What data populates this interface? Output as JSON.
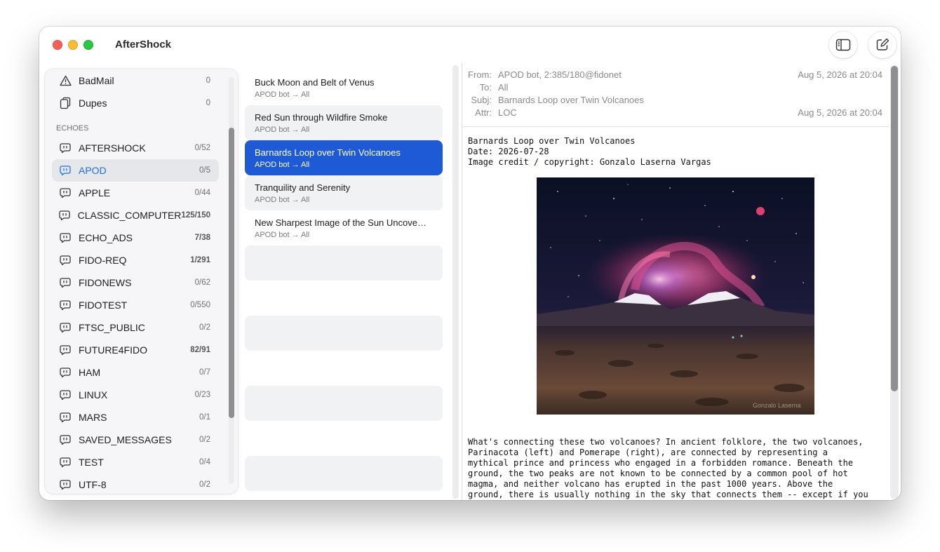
{
  "app": {
    "title": "AfterShock"
  },
  "toolbar": {
    "sidebar_icon": "sidebar-icon",
    "compose_icon": "compose-icon"
  },
  "sidebar": {
    "top_items": [
      {
        "label": "BadMail",
        "count": "0",
        "icon": "warning-icon"
      },
      {
        "label": "Dupes",
        "count": "0",
        "icon": "copy-icon"
      }
    ],
    "section_title": "ECHOES",
    "echoes": [
      {
        "label": "AFTERSHOCK",
        "count": "0/52"
      },
      {
        "label": "APOD",
        "count": "0/5",
        "selected": true
      },
      {
        "label": "APPLE",
        "count": "0/44"
      },
      {
        "label": "CLASSIC_COMPUTER",
        "count": "125/150",
        "unread": true
      },
      {
        "label": "ECHO_ADS",
        "count": "7/38",
        "unread": true
      },
      {
        "label": "FIDO-REQ",
        "count": "1/291",
        "unread": true
      },
      {
        "label": "FIDONEWS",
        "count": "0/62"
      },
      {
        "label": "FIDOTEST",
        "count": "0/550"
      },
      {
        "label": "FTSC_PUBLIC",
        "count": "0/2"
      },
      {
        "label": "FUTURE4FIDO",
        "count": "82/91",
        "unread": true
      },
      {
        "label": "HAM",
        "count": "0/7"
      },
      {
        "label": "LINUX",
        "count": "0/23"
      },
      {
        "label": "MARS",
        "count": "0/1"
      },
      {
        "label": "SAVED_MESSAGES",
        "count": "0/2"
      },
      {
        "label": "TEST",
        "count": "0/4"
      },
      {
        "label": "UTF-8",
        "count": "0/2"
      }
    ]
  },
  "messages": [
    {
      "subject": "Buck Moon and Belt of Venus",
      "from": "APOD bot → All"
    },
    {
      "subject": "Red Sun through Wildfire Smoke",
      "from": "APOD bot → All"
    },
    {
      "subject": "Barnards Loop over Twin Volcanoes",
      "from": "APOD bot → All",
      "selected": true
    },
    {
      "subject": "Tranquility and Serenity",
      "from": "APOD bot → All"
    },
    {
      "subject": "New Sharpest Image of the Sun Uncove…",
      "from": "APOD bot → All"
    }
  ],
  "reader": {
    "header": {
      "from_label": "From:",
      "from_value": "APOD bot, 2:385/180@fidonet",
      "to_label": "To:",
      "to_value": "All",
      "subj_label": "Subj:",
      "subj_value": "Barnards Loop over Twin Volcanoes",
      "attr_label": "Attr:",
      "attr_value": "LOC",
      "date_1": "Aug 5, 2026 at 20:04",
      "date_2": "Aug 5, 2026 at 20:04"
    },
    "body_intro": [
      "Barnards Loop over Twin Volcanoes",
      "Date: 2026-07-28",
      "Image credit / copyright: Gonzalo Laserna Vargas"
    ],
    "photo_watermark": "Gonzalo Laserna",
    "body_text": [
      "What's connecting these two volcanoes? In ancient folklore, the two volcanoes,",
      "Parinacota (left) and Pomerape (right), are connected by representing a",
      "mythical prince and princess who engaged in a forbidden romance. Beneath the",
      "ground, the two peaks are not known to be connected by a common pool of hot",
      "magma, and neither volcano has erupted in the past 1000 years. Above the",
      "ground, there is usually nothing in the sky that connects them -- except if you"
    ]
  },
  "colors": {
    "accent": "#1e6fe6",
    "selection": "#1f5ad6"
  }
}
